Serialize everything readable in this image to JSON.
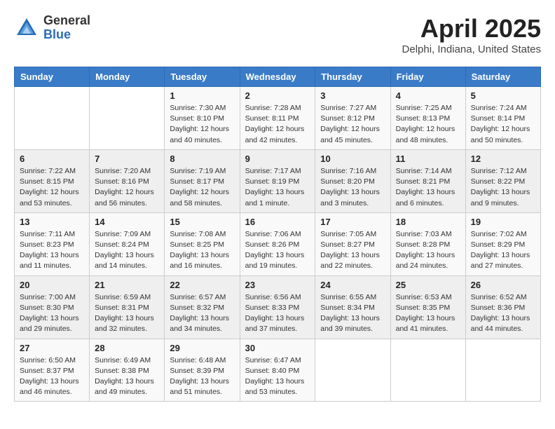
{
  "header": {
    "logo_general": "General",
    "logo_blue": "Blue",
    "title": "April 2025",
    "location": "Delphi, Indiana, United States"
  },
  "weekdays": [
    "Sunday",
    "Monday",
    "Tuesday",
    "Wednesday",
    "Thursday",
    "Friday",
    "Saturday"
  ],
  "rows": [
    [
      {
        "day": "",
        "info": ""
      },
      {
        "day": "",
        "info": ""
      },
      {
        "day": "1",
        "info": "Sunrise: 7:30 AM\nSunset: 8:10 PM\nDaylight: 12 hours and 40 minutes."
      },
      {
        "day": "2",
        "info": "Sunrise: 7:28 AM\nSunset: 8:11 PM\nDaylight: 12 hours and 42 minutes."
      },
      {
        "day": "3",
        "info": "Sunrise: 7:27 AM\nSunset: 8:12 PM\nDaylight: 12 hours and 45 minutes."
      },
      {
        "day": "4",
        "info": "Sunrise: 7:25 AM\nSunset: 8:13 PM\nDaylight: 12 hours and 48 minutes."
      },
      {
        "day": "5",
        "info": "Sunrise: 7:24 AM\nSunset: 8:14 PM\nDaylight: 12 hours and 50 minutes."
      }
    ],
    [
      {
        "day": "6",
        "info": "Sunrise: 7:22 AM\nSunset: 8:15 PM\nDaylight: 12 hours and 53 minutes."
      },
      {
        "day": "7",
        "info": "Sunrise: 7:20 AM\nSunset: 8:16 PM\nDaylight: 12 hours and 56 minutes."
      },
      {
        "day": "8",
        "info": "Sunrise: 7:19 AM\nSunset: 8:17 PM\nDaylight: 12 hours and 58 minutes."
      },
      {
        "day": "9",
        "info": "Sunrise: 7:17 AM\nSunset: 8:19 PM\nDaylight: 13 hours and 1 minute."
      },
      {
        "day": "10",
        "info": "Sunrise: 7:16 AM\nSunset: 8:20 PM\nDaylight: 13 hours and 3 minutes."
      },
      {
        "day": "11",
        "info": "Sunrise: 7:14 AM\nSunset: 8:21 PM\nDaylight: 13 hours and 6 minutes."
      },
      {
        "day": "12",
        "info": "Sunrise: 7:12 AM\nSunset: 8:22 PM\nDaylight: 13 hours and 9 minutes."
      }
    ],
    [
      {
        "day": "13",
        "info": "Sunrise: 7:11 AM\nSunset: 8:23 PM\nDaylight: 13 hours and 11 minutes."
      },
      {
        "day": "14",
        "info": "Sunrise: 7:09 AM\nSunset: 8:24 PM\nDaylight: 13 hours and 14 minutes."
      },
      {
        "day": "15",
        "info": "Sunrise: 7:08 AM\nSunset: 8:25 PM\nDaylight: 13 hours and 16 minutes."
      },
      {
        "day": "16",
        "info": "Sunrise: 7:06 AM\nSunset: 8:26 PM\nDaylight: 13 hours and 19 minutes."
      },
      {
        "day": "17",
        "info": "Sunrise: 7:05 AM\nSunset: 8:27 PM\nDaylight: 13 hours and 22 minutes."
      },
      {
        "day": "18",
        "info": "Sunrise: 7:03 AM\nSunset: 8:28 PM\nDaylight: 13 hours and 24 minutes."
      },
      {
        "day": "19",
        "info": "Sunrise: 7:02 AM\nSunset: 8:29 PM\nDaylight: 13 hours and 27 minutes."
      }
    ],
    [
      {
        "day": "20",
        "info": "Sunrise: 7:00 AM\nSunset: 8:30 PM\nDaylight: 13 hours and 29 minutes."
      },
      {
        "day": "21",
        "info": "Sunrise: 6:59 AM\nSunset: 8:31 PM\nDaylight: 13 hours and 32 minutes."
      },
      {
        "day": "22",
        "info": "Sunrise: 6:57 AM\nSunset: 8:32 PM\nDaylight: 13 hours and 34 minutes."
      },
      {
        "day": "23",
        "info": "Sunrise: 6:56 AM\nSunset: 8:33 PM\nDaylight: 13 hours and 37 minutes."
      },
      {
        "day": "24",
        "info": "Sunrise: 6:55 AM\nSunset: 8:34 PM\nDaylight: 13 hours and 39 minutes."
      },
      {
        "day": "25",
        "info": "Sunrise: 6:53 AM\nSunset: 8:35 PM\nDaylight: 13 hours and 41 minutes."
      },
      {
        "day": "26",
        "info": "Sunrise: 6:52 AM\nSunset: 8:36 PM\nDaylight: 13 hours and 44 minutes."
      }
    ],
    [
      {
        "day": "27",
        "info": "Sunrise: 6:50 AM\nSunset: 8:37 PM\nDaylight: 13 hours and 46 minutes."
      },
      {
        "day": "28",
        "info": "Sunrise: 6:49 AM\nSunset: 8:38 PM\nDaylight: 13 hours and 49 minutes."
      },
      {
        "day": "29",
        "info": "Sunrise: 6:48 AM\nSunset: 8:39 PM\nDaylight: 13 hours and 51 minutes."
      },
      {
        "day": "30",
        "info": "Sunrise: 6:47 AM\nSunset: 8:40 PM\nDaylight: 13 hours and 53 minutes."
      },
      {
        "day": "",
        "info": ""
      },
      {
        "day": "",
        "info": ""
      },
      {
        "day": "",
        "info": ""
      }
    ]
  ]
}
